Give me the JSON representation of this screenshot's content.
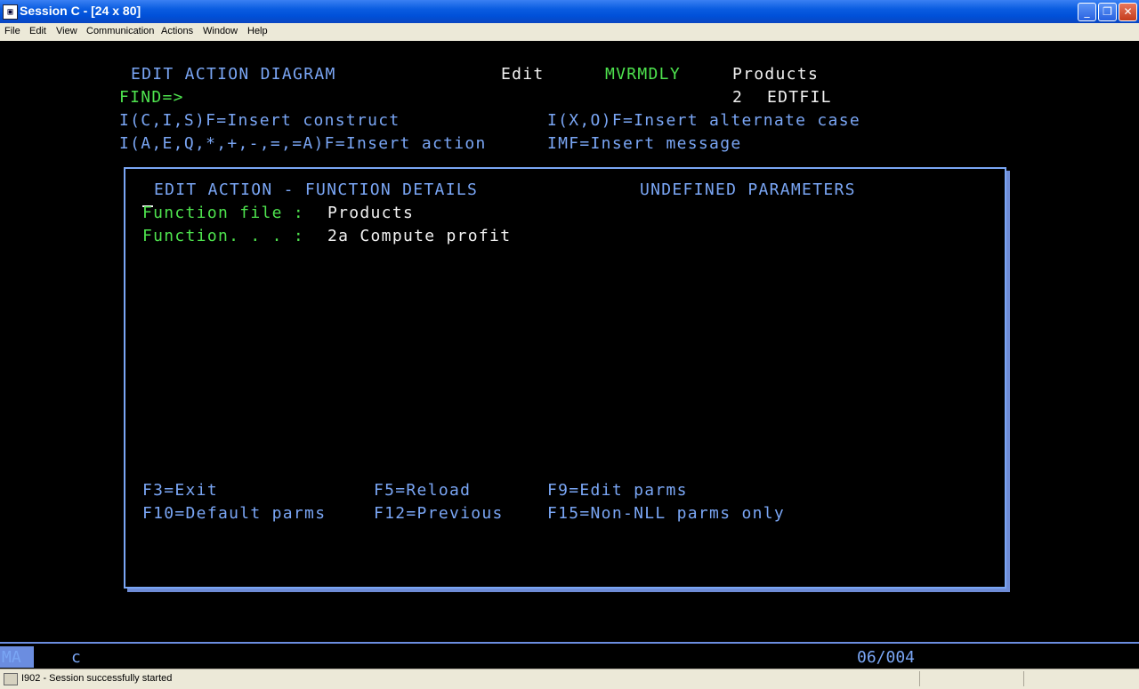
{
  "window": {
    "title": "Session C - [24 x 80]",
    "icon": "emulator-icon"
  },
  "menu": [
    "File",
    "Edit",
    "View",
    "Communication",
    "Actions",
    "Window",
    "Help"
  ],
  "screen": {
    "header_title": "EDIT ACTION DIAGRAM",
    "mode": "Edit",
    "program": "MVRMDLY",
    "file": "Products",
    "find_label": "FIND=>",
    "find_value": "",
    "level": "2",
    "function_type": "EDTFIL",
    "hint_1": "I(C,I,S)F=Insert construct",
    "hint_2": "I(X,O)F=Insert alternate case",
    "hint_3": "I(A,E,Q,*,+,-,=,=A)F=Insert action",
    "hint_4": "IMF=Insert message",
    "popup": {
      "title": "EDIT ACTION - FUNCTION DETAILS",
      "subtitle": "UNDEFINED PARAMETERS",
      "function_file_label": "Function file :",
      "function_file_value": "Products",
      "function_label": "Function. . . :",
      "function_value": "2a Compute profit",
      "keys": {
        "f3": "F3=Exit",
        "f5": "F5=Reload",
        "f9": "F9=Edit parms",
        "f10": "F10=Default parms",
        "f12": "F12=Previous",
        "f15": "F15=Non-NLL parms only"
      }
    }
  },
  "oia": {
    "ma": "MA",
    "indicator": "c",
    "cursor_position": "06/004"
  },
  "status": {
    "message": "I902 - Session successfully started"
  }
}
